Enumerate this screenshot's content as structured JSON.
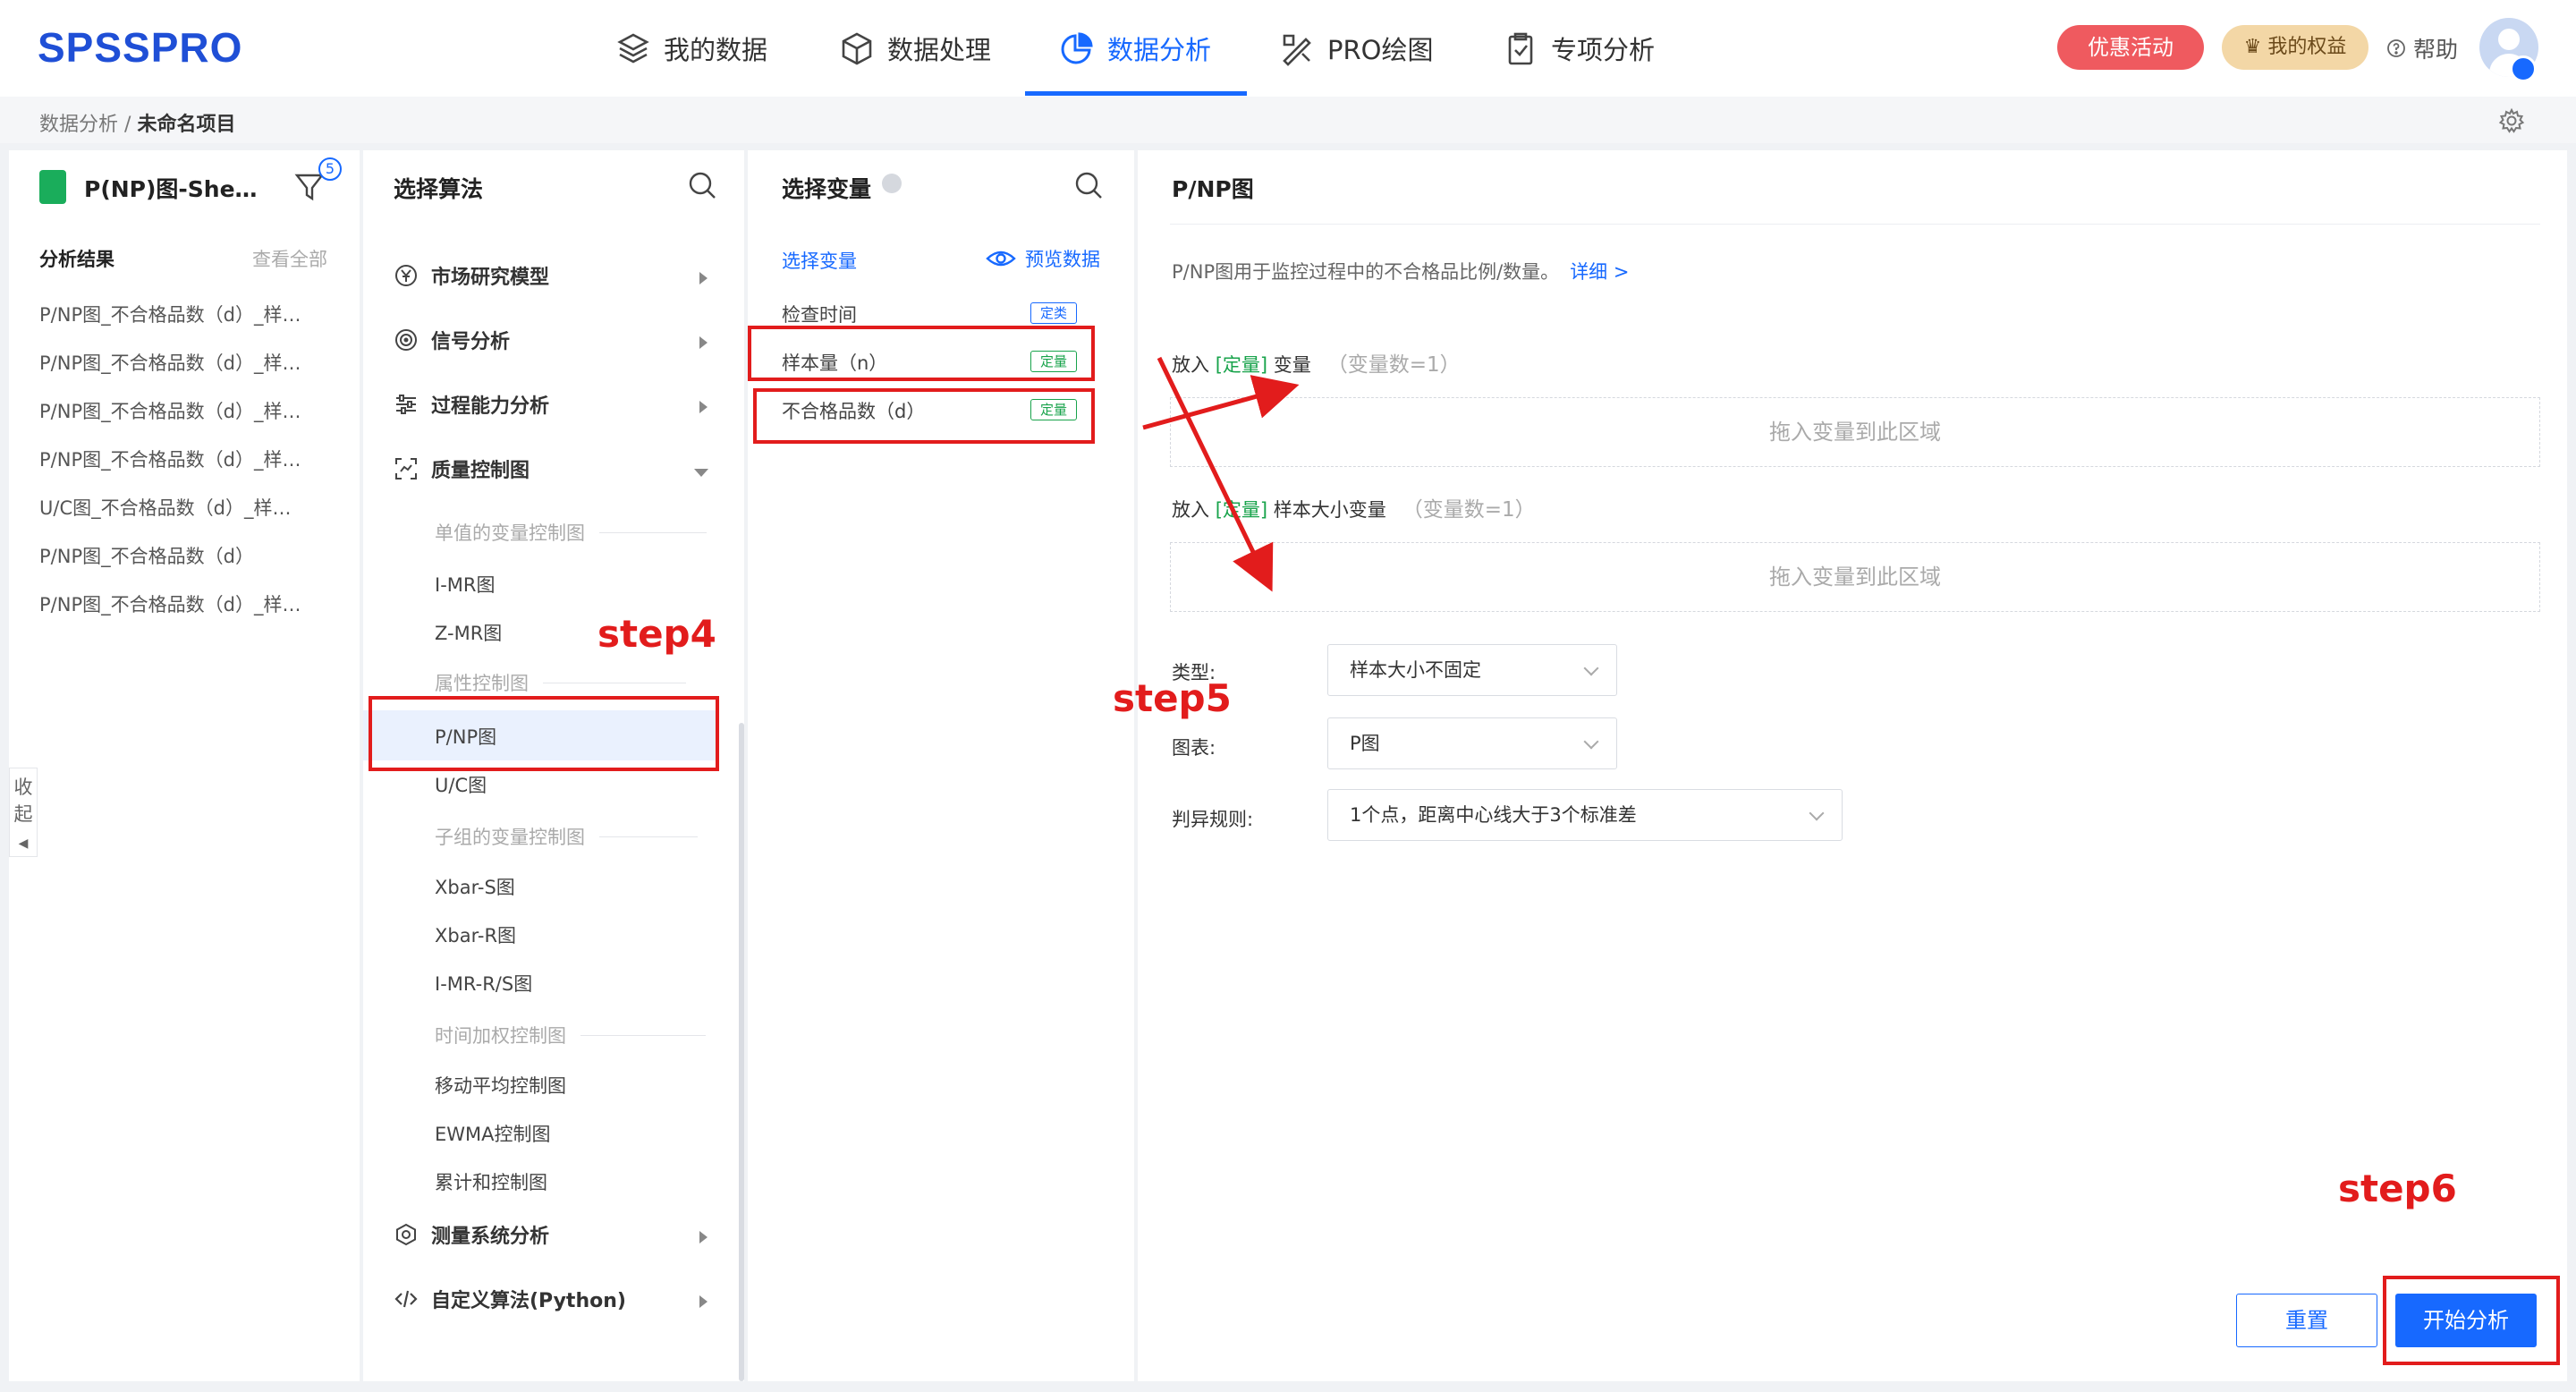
{
  "app": {
    "logo": "SPSSPRO"
  },
  "nav": [
    {
      "label": "我的数据",
      "icon": "layers-icon"
    },
    {
      "label": "数据处理",
      "icon": "cube-icon"
    },
    {
      "label": "数据分析",
      "icon": "pie-chart-icon",
      "active": true
    },
    {
      "label": "PRO绘图",
      "icon": "drawing-tools-icon"
    },
    {
      "label": "专项分析",
      "icon": "clipboard-icon"
    }
  ],
  "header": {
    "promo": "优惠活动",
    "rights": "我的权益",
    "help": "帮助"
  },
  "breadcrumb": {
    "parent": "数据分析",
    "separator": "/",
    "current": "未命名项目"
  },
  "panel_results": {
    "sheet_title": "P(NP)图-She…",
    "filter_count": "5",
    "section_label": "分析结果",
    "view_all": "查看全部",
    "items": [
      "P/NP图_不合格品数（d）_样…",
      "P/NP图_不合格品数（d）_样…",
      "P/NP图_不合格品数（d）_样…",
      "P/NP图_不合格品数（d）_样…",
      "U/C图_不合格品数（d）_样…",
      "P/NP图_不合格品数（d）",
      "P/NP图_不合格品数（d）_样…"
    ],
    "collapse": "收起"
  },
  "panel_algorithm": {
    "title": "选择算法",
    "categories": {
      "market": "市场研究模型",
      "signal": "信号分析",
      "process": "过程能力分析",
      "quality": "质量控制图",
      "measure": "测量系统分析",
      "custom": "自定义算法(Python)"
    },
    "subheads": [
      "单值的变量控制图",
      "属性控制图",
      "子组的变量控制图",
      "时间加权控制图"
    ],
    "items": {
      "imr": "I-MR图",
      "zmr": "Z-MR图",
      "pnp": "P/NP图",
      "uc": "U/C图",
      "xbars": "Xbar-S图",
      "xbarr": "Xbar-R图",
      "imrrs": "I-MR-R/S图",
      "ma": "移动平均控制图",
      "ewma": "EWMA控制图",
      "cusum": "累计和控制图"
    }
  },
  "panel_variables": {
    "title": "选择变量",
    "tab": "选择变量",
    "preview": "预览数据",
    "vars": [
      {
        "name": "检查时间",
        "tag": "定类"
      },
      {
        "name": "样本量（n）",
        "tag": "定量"
      },
      {
        "name": "不合格品数（d）",
        "tag": "定量"
      }
    ]
  },
  "panel_config": {
    "title": "P/NP图",
    "desc": "P/NP图用于监控过程中的不合格品比例/数量。",
    "detail_link": "详细 >",
    "slot1": {
      "prefix": "放入",
      "tag": "[定量]",
      "suffix": "变量",
      "hint": "（变量数=1）"
    },
    "slot2": {
      "prefix": "放入",
      "tag": "[定量]",
      "suffix": "样本大小变量",
      "hint": "（变量数=1）"
    },
    "drop_text": "拖入变量到此区域",
    "fields": {
      "type_label": "类型:",
      "type_value": "样本大小不固定",
      "chart_label": "图表:",
      "chart_value": "P图",
      "rule_label": "判异规则:",
      "rule_value": "1个点，距离中心线大于3个标准差"
    },
    "reset": "重置",
    "start": "开始分析"
  },
  "annotations": {
    "step4": "step4",
    "step5": "step5",
    "step6": "step6"
  },
  "colors": {
    "accent": "#1769ff",
    "promo": "#ef5a5f",
    "annotation": "#e21c1c",
    "quant_tag": "#18a34b"
  }
}
